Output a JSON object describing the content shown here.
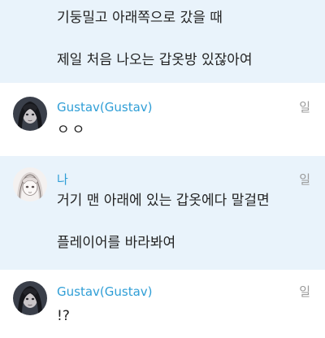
{
  "messages": [
    {
      "side": "mine",
      "name": "",
      "day": "",
      "lines": [
        "기둥밀고 아래쪽으로 갔을 때",
        "제일 처음 나오는 갑옷방 있잖아여"
      ]
    },
    {
      "side": "other",
      "name": "Gustav(Gustav)",
      "day": "일",
      "lines": [
        "ㅇㅇ"
      ]
    },
    {
      "side": "mine",
      "name": "나",
      "day": "일",
      "lines": [
        "거기 맨 아래에 있는 갑옷에다 말걸면",
        "플레이어를 바라봐여"
      ]
    },
    {
      "side": "other",
      "name": "Gustav(Gustav)",
      "day": "일",
      "lines": [
        "!?"
      ]
    }
  ],
  "colors": {
    "mine_bg": "#e9f3fb",
    "name": "#2f9ed6",
    "timestamp": "#9a9a9a",
    "text": "#222222"
  },
  "icons": {
    "gustav_avatar": "dark-haired-character-avatar-icon",
    "my_avatar": "light-haired-character-avatar-icon"
  }
}
